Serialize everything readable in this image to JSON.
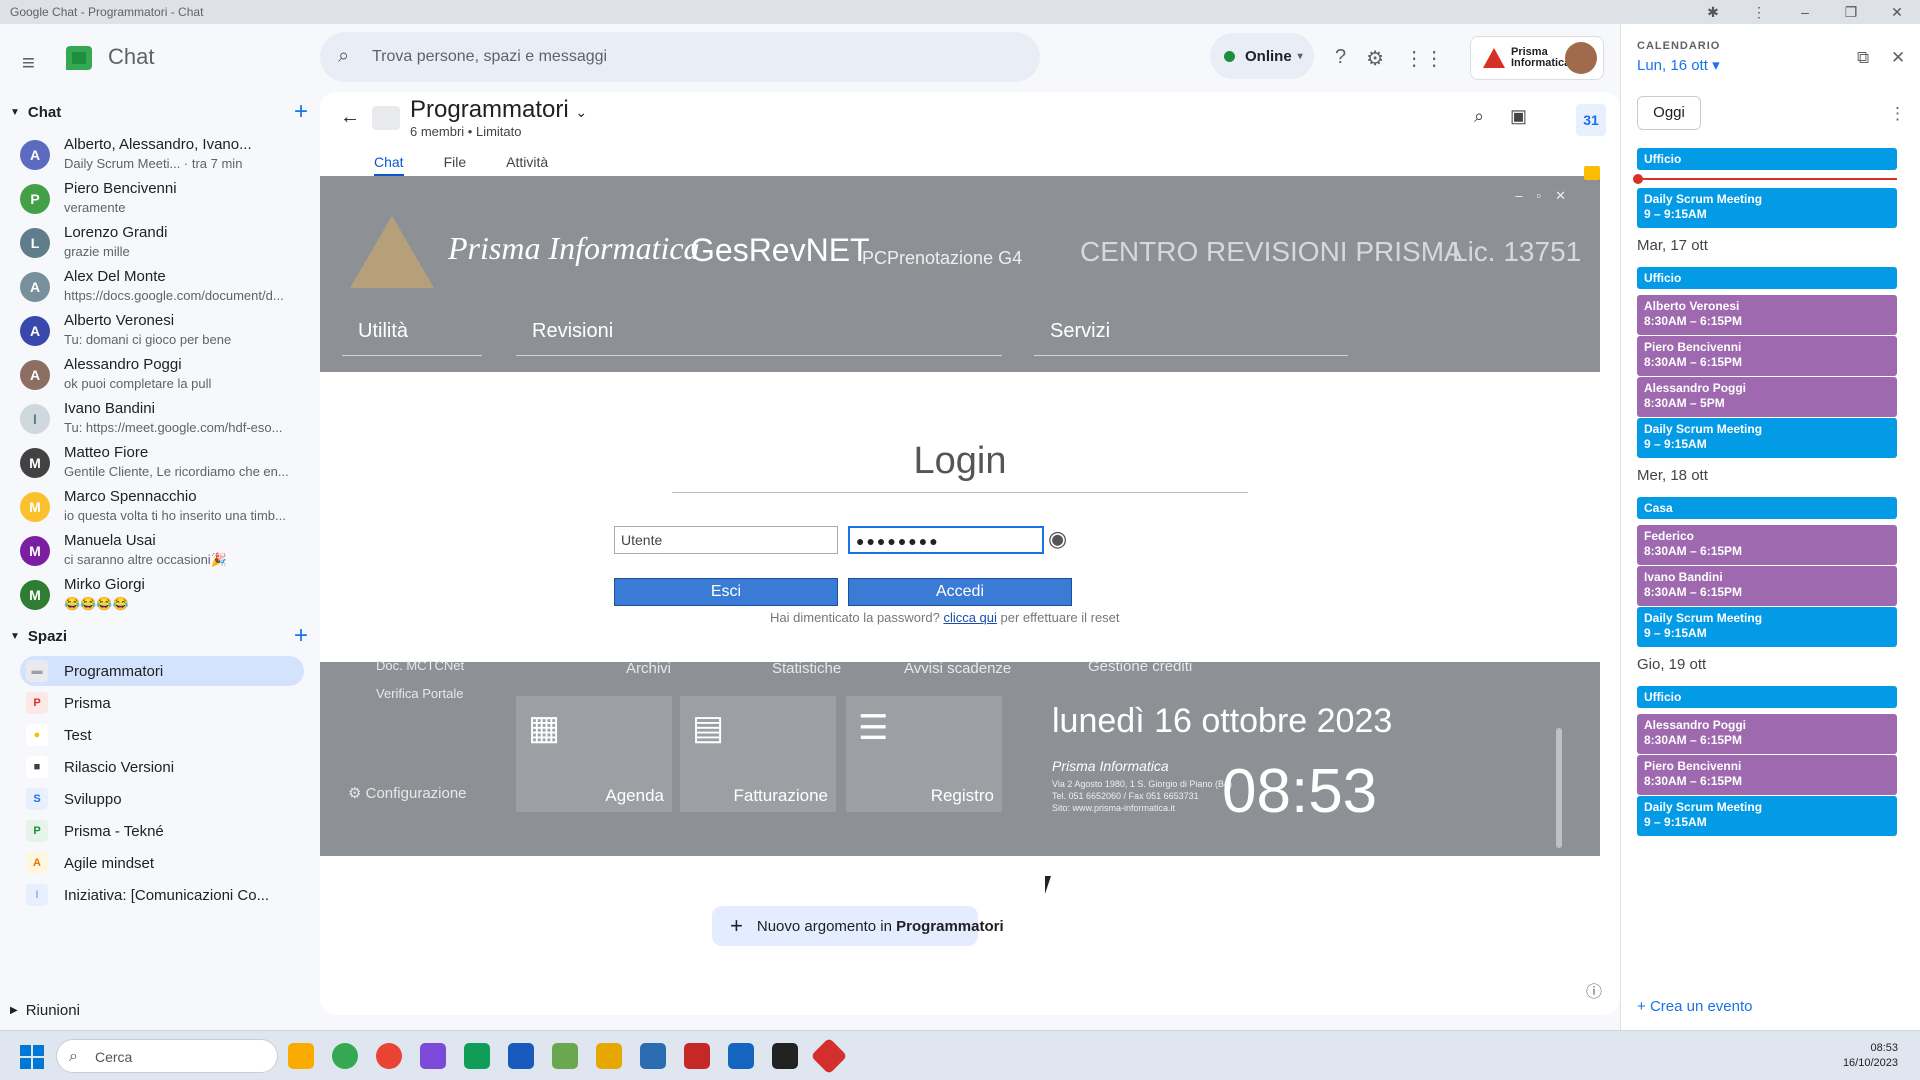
{
  "window": {
    "title": "Google Chat - Programmatori - Chat"
  },
  "header": {
    "app_name": "Chat",
    "search_placeholder": "Trova persone, spazi e messaggi",
    "status": "Online",
    "brand_text": "Prisma Informatica"
  },
  "chat_section": {
    "title": "Chat",
    "items": [
      {
        "name": "Alberto, Alessandro, Ivano...",
        "sub": "Daily Scrum Meeti...  · tra 7 min"
      },
      {
        "name": "Piero Bencivenni",
        "sub": "veramente"
      },
      {
        "name": "Lorenzo Grandi",
        "sub": "grazie mille"
      },
      {
        "name": "Alex Del Monte",
        "sub": "https://docs.google.com/document/d..."
      },
      {
        "name": "Alberto Veronesi",
        "sub": "Tu: domani ci gioco per bene"
      },
      {
        "name": "Alessandro Poggi",
        "sub": "ok puoi completare la pull"
      },
      {
        "name": "Ivano Bandini",
        "sub": "Tu: https://meet.google.com/hdf-eso..."
      },
      {
        "name": "Matteo Fiore",
        "sub": "Gentile Cliente, Le ricordiamo che en..."
      },
      {
        "name": "Marco Spennacchio",
        "sub": "io questa volta ti ho inserito una timb..."
      },
      {
        "name": "Manuela Usai",
        "sub": "ci saranno altre occasioni🎉"
      },
      {
        "name": "Mirko Giorgi",
        "sub": "😂😂😂😂"
      }
    ]
  },
  "spaces_section": {
    "title": "Spazi",
    "items": [
      {
        "label": "Programmatori",
        "icon": "▬"
      },
      {
        "label": "Prisma",
        "icon": "P"
      },
      {
        "label": "Test",
        "icon": "●"
      },
      {
        "label": "Rilascio Versioni",
        "icon": "■"
      },
      {
        "label": "Sviluppo",
        "icon": "S"
      },
      {
        "label": "Prisma - Tekné",
        "icon": "P"
      },
      {
        "label": "Agile mindset",
        "icon": "A"
      },
      {
        "label": "Iniziativa: [Comunicazioni Co...",
        "icon": "I"
      }
    ]
  },
  "meetings_section": {
    "title": "Riunioni"
  },
  "room": {
    "title": "Programmatori",
    "members": "6 membri",
    "access": "Limitato",
    "tabs": [
      "Chat",
      "File",
      "Attività"
    ]
  },
  "gesrev": {
    "brand": "Prisma Informatica",
    "app": "GesRevNET",
    "version": "PCPrenotazione G4",
    "centro": "CENTRO REVISIONI PRISMA",
    "lic": "Lic. 13751",
    "nav": [
      "Utilità",
      "Revisioni",
      "Servizi"
    ],
    "login_title": "Login",
    "user_value": "Utente",
    "password_value": "●●●●●●●●",
    "btn_exit": "Esci",
    "btn_login": "Accedi",
    "forgot_pre": "Hai dimenticato la password?",
    "forgot_link": "clicca qui",
    "forgot_post": "per effettuare il reset",
    "bottom_labels": [
      "Doc. MCTCNet",
      "Verifica Portale",
      "Configurazione",
      "Archivi",
      "Statistiche",
      "Avvisi scadenze",
      "Gestione crediti"
    ],
    "tiles": [
      "Agenda",
      "Fatturazione",
      "Registro"
    ],
    "date": "lunedì 16 ottobre 2023",
    "time": "08:53",
    "address": "Via 2 Agosto 1980, 1 S. Giorgio di Piano (Bo)\nTel. 051 6652060 / Fax 051 6653731\nSito: www.prisma-informatica.it"
  },
  "new_topic": {
    "prefix": "Nuovo argomento in ",
    "space": "Programmatori"
  },
  "calendar": {
    "label": "CALENDARIO",
    "day": "Lun, 16 ott",
    "today_btn": "Oggi",
    "create": "Crea un evento",
    "days": [
      {
        "head": "",
        "events": [
          {
            "kind": "allday",
            "title": "Ufficio"
          },
          {
            "kind": "blue",
            "title": "Daily Scrum Meeting",
            "time": "9 – 9:15AM"
          }
        ]
      },
      {
        "head": "Mar, 17 ott",
        "events": [
          {
            "kind": "allday",
            "title": "Ufficio"
          },
          {
            "kind": "purple",
            "title": "Alberto Veronesi",
            "time": "8:30AM – 6:15PM"
          },
          {
            "kind": "purple",
            "title": "Piero Bencivenni",
            "time": "8:30AM – 6:15PM"
          },
          {
            "kind": "purple",
            "title": "Alessandro Poggi",
            "time": "8:30AM – 5PM"
          },
          {
            "kind": "blue",
            "title": "Daily Scrum Meeting",
            "time": "9 – 9:15AM"
          }
        ]
      },
      {
        "head": "Mer, 18 ott",
        "events": [
          {
            "kind": "allday",
            "title": "Casa"
          },
          {
            "kind": "purple",
            "title": "Federico",
            "time": "8:30AM – 6:15PM"
          },
          {
            "kind": "purple",
            "title": "Ivano Bandini",
            "time": "8:30AM – 6:15PM"
          },
          {
            "kind": "blue",
            "title": "Daily Scrum Meeting",
            "time": "9 – 9:15AM"
          }
        ]
      },
      {
        "head": "Gio, 19 ott",
        "events": [
          {
            "kind": "allday",
            "title": "Ufficio"
          },
          {
            "kind": "purple",
            "title": "Alessandro Poggi",
            "time": "8:30AM – 6:15PM"
          },
          {
            "kind": "purple",
            "title": "Piero Bencivenni",
            "time": "8:30AM – 6:15PM"
          },
          {
            "kind": "blue",
            "title": "Daily Scrum Meeting",
            "time": "9 – 9:15AM"
          }
        ]
      }
    ]
  },
  "taskbar": {
    "search": "Cerca",
    "time": "08:53",
    "date": "16/10/2023"
  },
  "colors": {
    "accent": "#1a73e8",
    "event_blue": "#039be5",
    "event_purple": "#9e69af",
    "online": "#1e8e3e"
  }
}
